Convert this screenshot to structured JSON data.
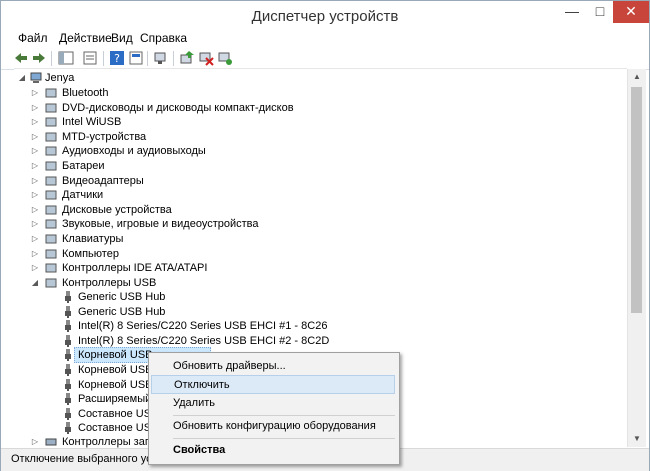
{
  "window": {
    "title": "Диспетчер устройств",
    "min_glyph": "—",
    "max_glyph": "□",
    "close_glyph": "✕"
  },
  "menu": [
    "Файл",
    "Действие",
    "Вид",
    "Справка"
  ],
  "tree": {
    "root": "Jenya",
    "categories": [
      {
        "label": "Bluetooth",
        "icon": "bluetooth-icon"
      },
      {
        "label": "DVD-дисководы и дисководы компакт-дисков",
        "icon": "dvd-drive-icon"
      },
      {
        "label": "Intel WiUSB",
        "icon": "wiusb-icon"
      },
      {
        "label": "MTD-устройства",
        "icon": "mtd-device-icon"
      },
      {
        "label": "Аудиовходы и аудиовыходы",
        "icon": "audio-icon"
      },
      {
        "label": "Батареи",
        "icon": "battery-icon"
      },
      {
        "label": "Видеоадаптеры",
        "icon": "display-adapter-icon"
      },
      {
        "label": "Датчики",
        "icon": "sensor-icon"
      },
      {
        "label": "Дисковые устройства",
        "icon": "disk-drive-icon"
      },
      {
        "label": "Звуковые, игровые и видеоустройства",
        "icon": "sound-icon"
      },
      {
        "label": "Клавиатуры",
        "icon": "keyboard-icon"
      },
      {
        "label": "Компьютер",
        "icon": "computer-icon"
      },
      {
        "label": "Контроллеры IDE ATA/ATAPI",
        "icon": "ide-controller-icon"
      },
      {
        "label": "Контроллеры USB",
        "icon": "usb-controller-icon"
      }
    ],
    "usb_children": [
      "Generic USB Hub",
      "Generic USB Hub",
      "Intel(R) 8 Series/C220 Series USB EHCI #1 - 8C26",
      "Intel(R) 8 Series/C220 Series USB EHCI #2 - 8C2D",
      "Корневой USB-концентратор",
      "Корневой USB-",
      "Корневой USB-",
      "Расширяемый",
      "Составное USB",
      "Составное USB"
    ],
    "after": "Контроллеры запо"
  },
  "context_menu": {
    "items": [
      "Обновить драйверы...",
      "Отключить",
      "Удалить",
      "Обновить конфигурацию оборудования",
      "Свойства"
    ],
    "highlighted_index": 1
  },
  "status": "Отключение выбранного устро"
}
